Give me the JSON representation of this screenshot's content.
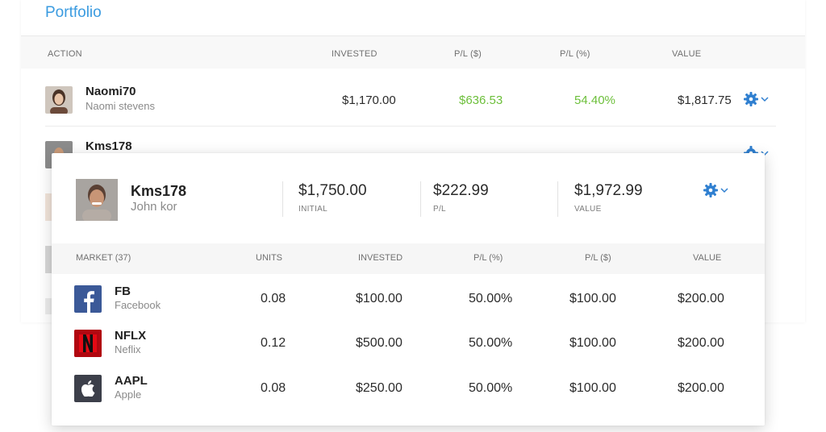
{
  "title": "Portfolio",
  "table_headers": {
    "action": "ACTION",
    "invested": "INVESTED",
    "pl_usd": "P/L ($)",
    "pl_pct": "P/L (%)",
    "value": "VALUE"
  },
  "rows": [
    {
      "username": "Naomi70",
      "name": "Naomi stevens",
      "invested": "$1,170.00",
      "pl_usd": "$636.53",
      "pl_pct": "54.40%",
      "value": "$1,817.75"
    },
    {
      "username": "Kms178"
    }
  ],
  "detail": {
    "username": "Kms178",
    "name": "John kor",
    "initial_value": "$1,750.00",
    "initial_label": "INITIAL",
    "pl_value": "$222.99",
    "pl_label": "P/L",
    "value_value": "$1,972.99",
    "value_label": "VALUE",
    "headers": {
      "market": "MARKET (37)",
      "units": "UNITS",
      "invested": "INVESTED",
      "pl_pct": "P/L (%)",
      "pl_usd": "P/L ($)",
      "value": "VALUE"
    },
    "markets": [
      {
        "symbol": "FB",
        "name": "Facebook",
        "icon": "facebook-logo",
        "units": "0.08",
        "invested": "$100.00",
        "pl_pct": "50.00%",
        "pl_usd": "$100.00",
        "value": "$200.00"
      },
      {
        "symbol": "NFLX",
        "name": "Neflix",
        "icon": "netflix-logo",
        "units": "0.12",
        "invested": "$500.00",
        "pl_pct": "50.00%",
        "pl_usd": "$100.00",
        "value": "$200.00"
      },
      {
        "symbol": "AAPL",
        "name": "Apple",
        "icon": "apple-logo",
        "units": "0.08",
        "invested": "$250.00",
        "pl_pct": "50.00%",
        "pl_usd": "$100.00",
        "value": "$200.00"
      }
    ]
  },
  "colors": {
    "accent": "#3a9be0",
    "positive": "#6cbf3a",
    "gear": "#2f7fd0"
  }
}
